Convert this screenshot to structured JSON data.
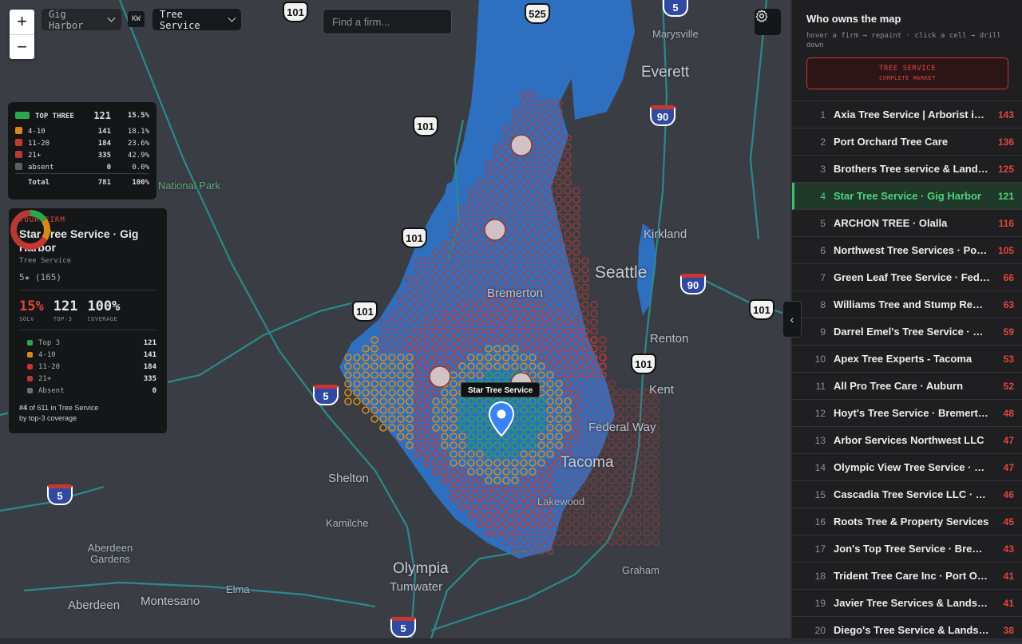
{
  "topbar": {
    "location": "Gig Harbor",
    "kw_label": "KW",
    "keyword": "Tree Service",
    "search_placeholder": "Find a firm..."
  },
  "map": {
    "places": {
      "everett": "Everett",
      "marysville": "Marysville",
      "seattle": "Seattle",
      "kirkland": "Kirkland",
      "renton": "Renton",
      "kent": "Kent",
      "federal_way": "Federal Way",
      "tacoma": "Tacoma",
      "lakewood": "Lakewood",
      "olympia": "Olympia",
      "tumwater": "Tumwater",
      "shelton": "Shelton",
      "kamilche": "Kamilche",
      "aberdeen_gardens": "Aberdeen Gardens",
      "aberdeen": "Aberdeen",
      "montesano": "Montesano",
      "elma": "Elma",
      "graham": "Graham",
      "bremerton": "Bremerton",
      "national_park": "National Park"
    },
    "shields": [
      "101",
      "525",
      "5",
      "101",
      "101",
      "101",
      "5",
      "90",
      "90",
      "101",
      "5",
      "101",
      "5"
    ],
    "pin_label": "Star Tree Service",
    "colors": {
      "top3": "#2ea44f",
      "r4_10": "#d68a1a",
      "r11_20": "#c8372f",
      "r21": "#b83a32",
      "absent": "#5a5e66"
    }
  },
  "legend": {
    "rows": [
      {
        "label": "TOP THREE",
        "count": "121",
        "pct": "15.5%",
        "color": "#2ea44f"
      },
      {
        "label": "4-10",
        "count": "141",
        "pct": "18.1%",
        "color": "#d68a1a"
      },
      {
        "label": "11-20",
        "count": "184",
        "pct": "23.6%",
        "color": "#c8372f"
      },
      {
        "label": "21+",
        "count": "335",
        "pct": "42.9%",
        "color": "#b83a32"
      },
      {
        "label": "absent",
        "count": "0",
        "pct": "0.0%",
        "color": "#5a5e66"
      }
    ],
    "total_label": "Total",
    "total_count": "781",
    "total_pct": "100%"
  },
  "firm": {
    "section_label": "YOUR FIRM",
    "name": "Star Tree Service · Gig Harbor",
    "category": "Tree Service",
    "rating": "5★ (165)",
    "solv": "15%",
    "solv_label": "SOLV",
    "top3": "121",
    "top3_label": "TOP-3",
    "coverage": "100%",
    "coverage_label": "COVERAGE",
    "breakdown": [
      {
        "label": "Top 3",
        "value": 121,
        "color": "#2ea44f"
      },
      {
        "label": "4-10",
        "value": 141,
        "color": "#d68a1a"
      },
      {
        "label": "11-20",
        "value": 184,
        "color": "#c8372f"
      },
      {
        "label": "21+",
        "value": 335,
        "color": "#b83a32"
      },
      {
        "label": "Absent",
        "value": 0,
        "color": "#6b6f76"
      }
    ],
    "rank_line1_bold": "#4",
    "rank_line1": "of 611 in Tree Service",
    "rank_line2": "by top-3 coverage"
  },
  "panel": {
    "title": "Who owns the map",
    "subtitle": "hover a firm → repaint · click a cell → drill down",
    "button_line1": "TREE SERVICE",
    "button_line2": "COMPLETE MARKET",
    "selected_rank": 4,
    "firms": [
      {
        "rank": "1",
        "name": "Axia Tree Service | Arborist in Gig Harbor",
        "count": "143"
      },
      {
        "rank": "2",
        "name": "Port Orchard Tree Care",
        "count": "136"
      },
      {
        "rank": "3",
        "name": "Brothers Tree service & Landscaping",
        "count": "125"
      },
      {
        "rank": "4",
        "name": "Star Tree Service · Gig Harbor",
        "count": "121"
      },
      {
        "rank": "5",
        "name": "ARCHON TREE · Olalla",
        "count": "116"
      },
      {
        "rank": "6",
        "name": "Northwest Tree Services · Port Orchard",
        "count": "105"
      },
      {
        "rank": "7",
        "name": "Green Leaf Tree Service · Federal Way",
        "count": "66"
      },
      {
        "rank": "8",
        "name": "Williams Tree and Stump Removal",
        "count": "63"
      },
      {
        "rank": "9",
        "name": "Darrel Emel's Tree Service · Shelton",
        "count": "59"
      },
      {
        "rank": "10",
        "name": "Apex Tree Experts - Tacoma",
        "count": "53"
      },
      {
        "rank": "11",
        "name": "All Pro Tree Care · Auburn",
        "count": "52"
      },
      {
        "rank": "12",
        "name": "Hoyt's Tree Service · Bremerton",
        "count": "48"
      },
      {
        "rank": "13",
        "name": "Arbor Services Northwest LLC",
        "count": "47"
      },
      {
        "rank": "14",
        "name": "Olympic View Tree Service · Port Orchard",
        "count": "47"
      },
      {
        "rank": "15",
        "name": "Cascadia Tree Service LLC · Puyallup",
        "count": "46"
      },
      {
        "rank": "16",
        "name": "Roots Tree & Property Services",
        "count": "45"
      },
      {
        "rank": "17",
        "name": "Jon's Top Tree Service · Bremerton",
        "count": "43"
      },
      {
        "rank": "18",
        "name": "Trident Tree Care Inc · Port Orchard",
        "count": "41"
      },
      {
        "rank": "19",
        "name": "Javier Tree Services & Landscaping",
        "count": "41"
      },
      {
        "rank": "20",
        "name": "Diego's Tree Service & Landscaping",
        "count": "38"
      }
    ]
  }
}
